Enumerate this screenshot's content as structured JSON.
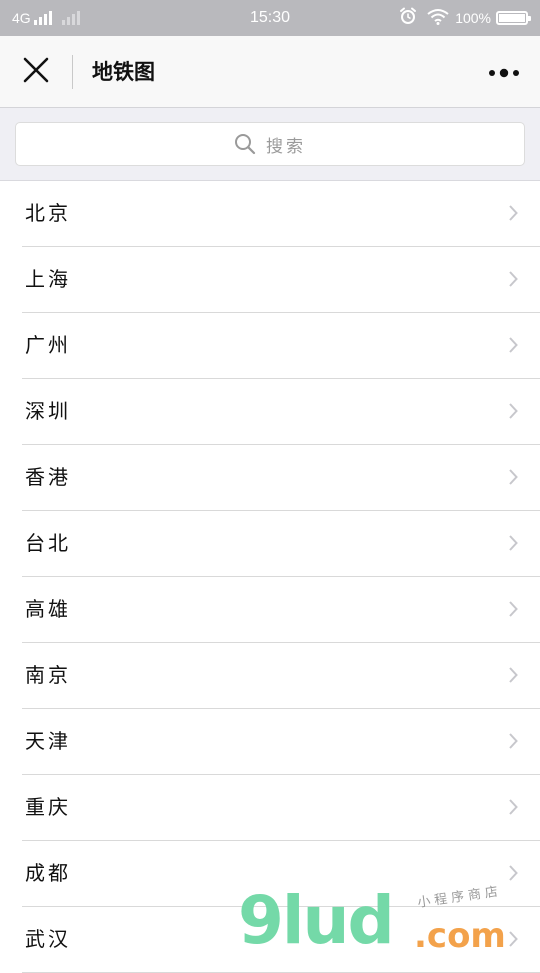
{
  "status_bar": {
    "carrier": "4G",
    "time": "15:30",
    "battery": "100%",
    "battery_level": 1.0
  },
  "nav": {
    "title": "地铁图",
    "close_icon": "close-icon",
    "more_icon": "more-dots-icon"
  },
  "search": {
    "placeholder": "搜索",
    "icon": "search-icon"
  },
  "cities": [
    {
      "label": "北京"
    },
    {
      "label": "上海"
    },
    {
      "label": "广州"
    },
    {
      "label": "深圳"
    },
    {
      "label": "香港"
    },
    {
      "label": "台北"
    },
    {
      "label": "高雄"
    },
    {
      "label": "南京"
    },
    {
      "label": "天津"
    },
    {
      "label": "重庆"
    },
    {
      "label": "成都"
    },
    {
      "label": "武汉"
    }
  ],
  "watermark": {
    "logo": "9lud",
    "domain": ".com",
    "tagline": "小程序商店"
  },
  "colors": {
    "status_bar_bg": "#b9b9bd",
    "nav_bg": "#f8f8f8",
    "search_area_bg": "#efeff4",
    "watermark_green": "#74d9a8",
    "watermark_orange": "#f3a24b"
  }
}
